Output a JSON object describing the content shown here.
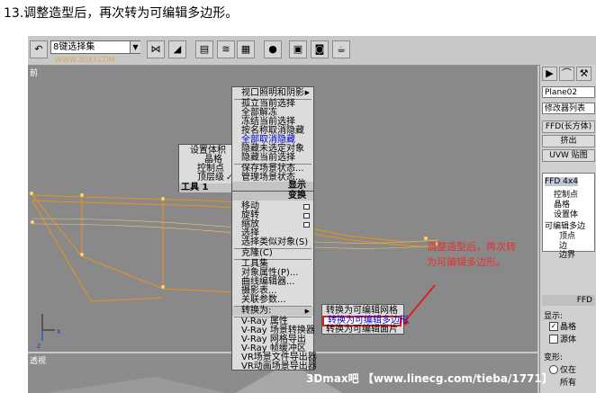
{
  "heading": "13.调整造型后，再次转为可编辑多边形。",
  "toolbar": {
    "selection_set": "8键选择集",
    "watermark": "WWW.3DXY.COM"
  },
  "viewports": {
    "front_label": "前",
    "persp_label": "透视"
  },
  "command_panel": {
    "object_name": "Plane02",
    "modifier_list": "修改器列表",
    "buttons": [
      "FFD(长方体)",
      "挤出",
      "UVW 贴图"
    ],
    "stack": [
      {
        "label": "FFD 4x4",
        "level": 0
      },
      {
        "label": "控制点",
        "level": 1
      },
      {
        "label": "晶格",
        "level": 1
      },
      {
        "label": "设置体",
        "level": 1
      },
      {
        "label": "可编辑多边",
        "level": 0
      },
      {
        "label": "顶点",
        "level": 1
      },
      {
        "label": "边",
        "level": 1
      },
      {
        "label": "边界",
        "level": 1
      }
    ],
    "rollout_title": "FFD",
    "display_label": "显示:",
    "lattice_check": "晶格",
    "source_check": "源体",
    "deform_label": "变形:",
    "radio1": "仅在",
    "radio2": "所有"
  },
  "quad_left": {
    "items": [
      "设置体积",
      "晶格",
      "控制点",
      "顶层级"
    ],
    "footer": "工具 1"
  },
  "quad_top": {
    "items": [
      "视口照明和阴影",
      "孤立当前选择",
      "全部解冻",
      "冻结当前选择",
      "按名称取消隐藏",
      "全部取消隐藏",
      "隐藏未选定对象",
      "隐藏当前选择",
      "保存场景状态...",
      "管理场景状态..."
    ],
    "footer": "显示"
  },
  "quad_bottom": {
    "header": "变换",
    "items": [
      "移动",
      "旋转",
      "缩放",
      "选择",
      "选择类似对象(S)",
      "克隆(C)",
      "工具集",
      "对象属性(P)...",
      "曲线编辑器...",
      "摄影表...",
      "关联参数...",
      "转换为:",
      "V-Ray 属性",
      "V-Ray 场景转换器",
      "V-Ray 网格导出",
      "V-Ray 帧缓冲区",
      "VR场景文件导出器",
      "VR动画场景导出器"
    ]
  },
  "submenu": {
    "items": [
      "转换为可编辑网格",
      "转换为可编辑多边形",
      "转换为可编辑面片"
    ]
  },
  "annotation": "调整造型后，再次转为可编辑多边形。",
  "bottom_watermark": "3Dmax吧  【www.linecg.com/tieba/1771】"
}
